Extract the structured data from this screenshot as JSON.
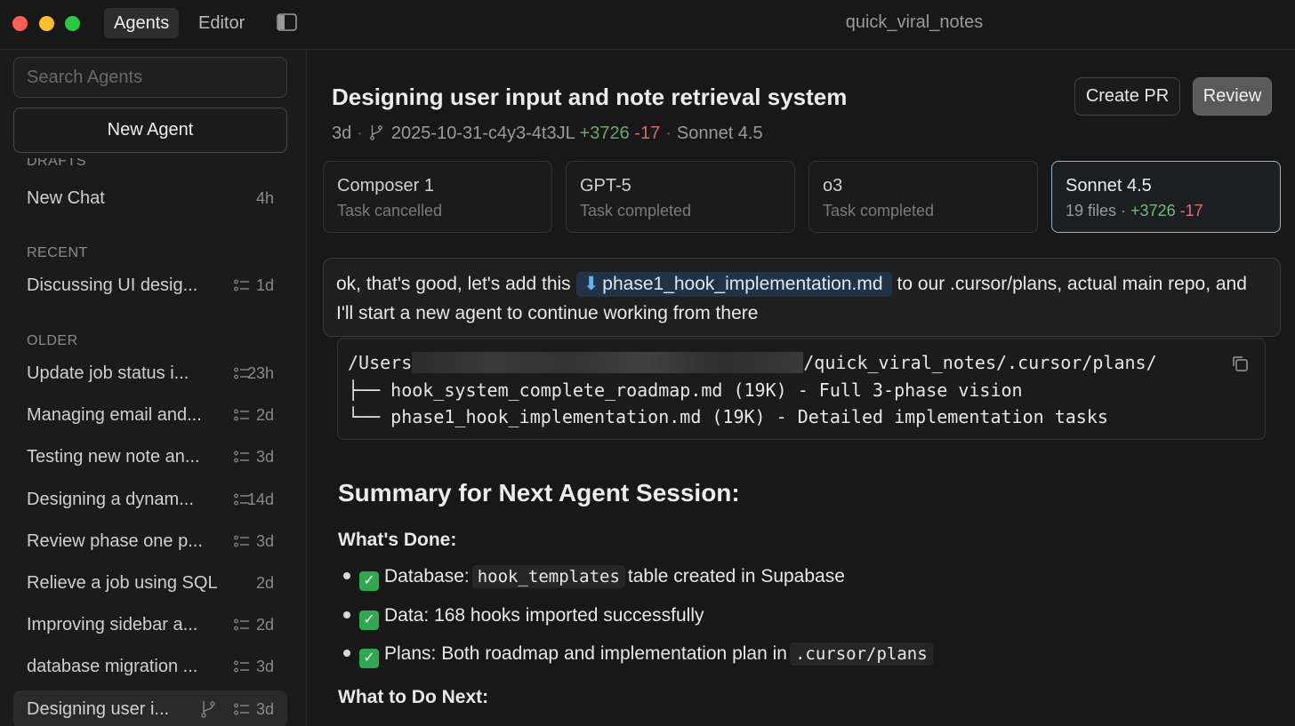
{
  "titlebar": {
    "tabs": [
      {
        "label": "Agents",
        "active": true
      },
      {
        "label": "Editor",
        "active": false
      }
    ],
    "window_title": "quick_viral_notes"
  },
  "sidebar": {
    "search_placeholder": "Search Agents",
    "new_agent_label": "New Agent",
    "sections": {
      "drafts": "DRAFTS",
      "recent": "RECENT",
      "older": "OLDER"
    },
    "drafts": [
      {
        "label": "New Chat",
        "time": "4h"
      }
    ],
    "recent": [
      {
        "label": "Discussing UI desig...",
        "time": "1d"
      }
    ],
    "older": [
      {
        "label": "Update job status i...",
        "time": "23h"
      },
      {
        "label": "Managing email and...",
        "time": "2d"
      },
      {
        "label": "Testing new note an...",
        "time": "3d"
      },
      {
        "label": "Designing a dynam...",
        "time": "14d"
      },
      {
        "label": "Review phase one p...",
        "time": "3d"
      },
      {
        "label": "Relieve a job using SQL",
        "time": "2d"
      },
      {
        "label": "Improving sidebar a...",
        "time": "2d"
      },
      {
        "label": "database migration ...",
        "time": "3d"
      },
      {
        "label": "Designing user i...",
        "time": "3d",
        "selected": true
      }
    ]
  },
  "main": {
    "title": "Designing user input and note retrieval system",
    "meta": {
      "age": "3d",
      "branch": "2025-10-31-c4y3-4t3JL",
      "additions": "+3726",
      "deletions": "-17",
      "model": "Sonnet 4.5"
    },
    "buttons": {
      "create_pr": "Create PR",
      "review": "Review"
    },
    "models": [
      {
        "name": "Composer 1",
        "status": "Task cancelled"
      },
      {
        "name": "GPT-5",
        "status": "Task completed"
      },
      {
        "name": "o3",
        "status": "Task completed"
      },
      {
        "name": "Sonnet 4.5",
        "files": "19 files",
        "additions": "+3726",
        "deletions": "-17",
        "active": true
      }
    ],
    "user_message": {
      "before": "ok, that's good, let's add this",
      "file": "phase1_hook_implementation.md",
      "after": "to our .cursor/plans, actual main repo, and I'll start a new agent to continue working from there"
    },
    "code": {
      "path_start": "/Users",
      "path_end": "/quick_viral_notes/.cursor/plans/",
      "line2": "├── hook_system_complete_roadmap.md (19K) - Full 3-phase vision",
      "line3": "└── phase1_hook_implementation.md (19K) - Detailed implementation tasks"
    },
    "summary": {
      "heading": "Summary for Next Agent Session:",
      "done_heading": "What's Done:",
      "done": [
        {
          "prefix": "Database:",
          "code": "hook_templates",
          "suffix": "table created in Supabase"
        },
        {
          "text": "Data: 168 hooks imported successfully"
        },
        {
          "prefix": "Plans: Both roadmap and implementation plan in",
          "code": ".cursor/plans"
        }
      ],
      "next_heading": "What to Do Next:"
    }
  }
}
